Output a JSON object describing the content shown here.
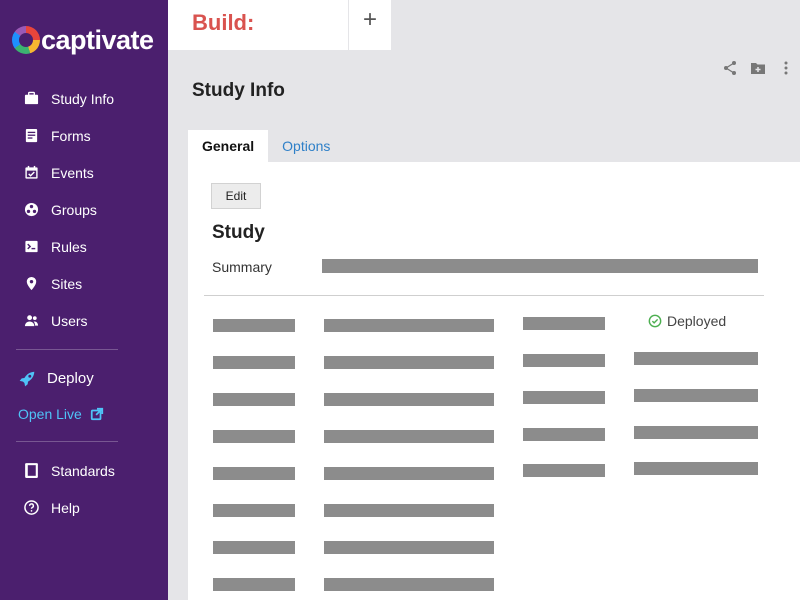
{
  "brand": {
    "name": "captivate"
  },
  "sidebar": {
    "items": [
      {
        "label": "Study Info",
        "icon": "briefcase-icon"
      },
      {
        "label": "Forms",
        "icon": "forms-icon"
      },
      {
        "label": "Events",
        "icon": "calendar-icon"
      },
      {
        "label": "Groups",
        "icon": "groups-icon"
      },
      {
        "label": "Rules",
        "icon": "rules-icon"
      },
      {
        "label": "Sites",
        "icon": "location-pin-icon"
      },
      {
        "label": "Users",
        "icon": "users-icon"
      }
    ],
    "deploy": {
      "label": "Deploy",
      "icon": "rocket-icon"
    },
    "open_live": {
      "label": "Open Live",
      "icon": "external-link-icon"
    },
    "bottom_items": [
      {
        "label": "Standards",
        "icon": "book-icon"
      },
      {
        "label": "Help",
        "icon": "help-icon"
      }
    ]
  },
  "topbar": {
    "build_label": "Build:",
    "add_label": "+"
  },
  "page": {
    "title": "Study Info",
    "tabs": [
      {
        "label": "General",
        "active": true
      },
      {
        "label": "Options",
        "active": false
      }
    ],
    "edit_label": "Edit",
    "section_title": "Study",
    "summary_label": "Summary",
    "status_label": "Deployed"
  },
  "colors": {
    "sidebar_bg": "#4b1f6e",
    "build_red": "#d9534f",
    "link_blue": "#2f80c8",
    "deployed_green": "#4caf50",
    "placeholder_gray": "#8c8c8c"
  }
}
